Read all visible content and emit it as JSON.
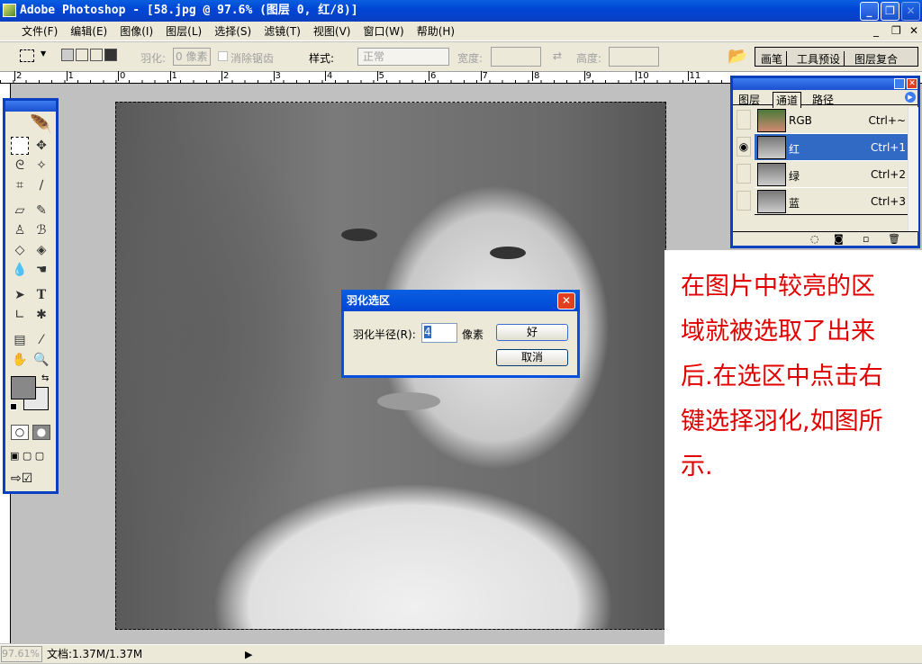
{
  "window": {
    "title": "Adobe Photoshop - [58.jpg @ 97.6% (图层 0, 红/8)]"
  },
  "menu": [
    "文件(F)",
    "编辑(E)",
    "图像(I)",
    "图层(L)",
    "选择(S)",
    "滤镜(T)",
    "视图(V)",
    "窗口(W)",
    "帮助(H)"
  ],
  "options": {
    "feather_label": "羽化:",
    "feather_value": "0 像素",
    "antialias_label": "消除锯齿",
    "style_label": "样式:",
    "style_value": "正常",
    "width_label": "宽度:",
    "height_label": "高度:"
  },
  "palette_well": [
    "画笔",
    "工具预设",
    "图层复合"
  ],
  "ruler_top": [
    "2",
    "1",
    "0",
    "1",
    "2",
    "3",
    "4",
    "5",
    "6",
    "7",
    "8",
    "9",
    "10",
    "11"
  ],
  "channels_panel": {
    "tabs": [
      "图层",
      "通道",
      "路径"
    ],
    "active_tab": "通道",
    "rows": [
      {
        "name": "RGB",
        "shortcut": "Ctrl+~",
        "visible": false,
        "selected": false
      },
      {
        "name": "红",
        "shortcut": "Ctrl+1",
        "visible": true,
        "selected": true
      },
      {
        "name": "绿",
        "shortcut": "Ctrl+2",
        "visible": false,
        "selected": false
      },
      {
        "name": "蓝",
        "shortcut": "Ctrl+3",
        "visible": false,
        "selected": false
      }
    ]
  },
  "dialog": {
    "title": "羽化选区",
    "radius_label": "羽化半径(R):",
    "radius_value": "4",
    "unit": "像素",
    "ok": "好",
    "cancel": "取消"
  },
  "annotation": [
    "在图片中较亮的区",
    "域就被选取了出来",
    "后.在选区中点击右",
    "键选择羽化,如图所",
    "示."
  ],
  "status": {
    "zoom": "97.61%",
    "doc": "文档:1.37M/1.37M"
  },
  "colors": {
    "accent": "#0a50e0",
    "annotation": "#e00000",
    "selected_row": "#316ac5"
  }
}
